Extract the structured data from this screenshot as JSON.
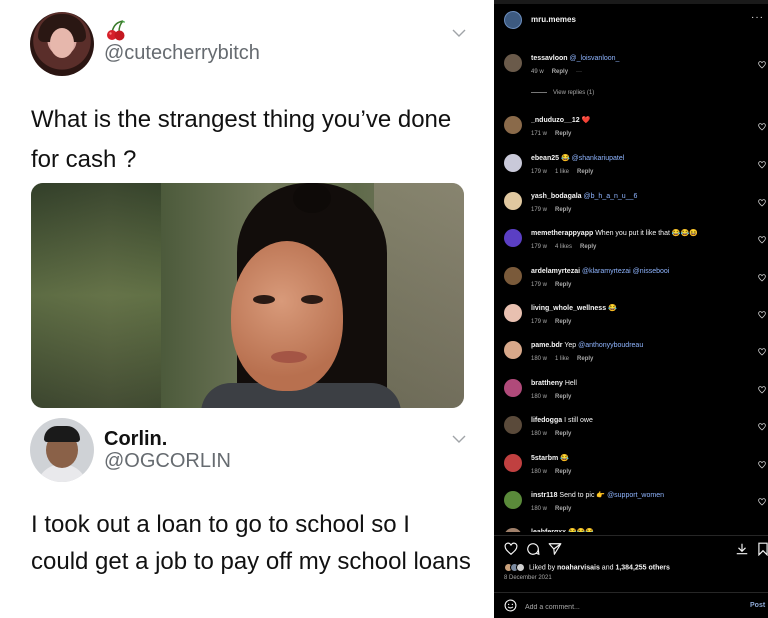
{
  "tweet1": {
    "handle": "@cutecherrybitch",
    "text": "What is the strangest thing you’ve done for cash ?"
  },
  "tweet2": {
    "name": "Corlin.",
    "handle": "@OGCORLIN",
    "text": "I took out a loan to go to school so I could get a job to pay off my school loans"
  },
  "panel": {
    "username": "mru.memes",
    "more_icon": "···"
  },
  "comments": [
    {
      "user": "tessavloon",
      "mention": "@_loisvanloon_",
      "text": "",
      "time": "49 w",
      "likes": "",
      "reply": "Reply",
      "extra": "···",
      "view_replies": "View replies (1)",
      "avatar_color": "#6a5a4a"
    },
    {
      "user": "_nduduzo__12",
      "mention": "",
      "text": "❤️",
      "time": "171 w",
      "likes": "",
      "reply": "Reply",
      "avatar_color": "#8a6a4a"
    },
    {
      "user": "ebean25",
      "mention": "@shankariupatel",
      "text": "😂",
      "time": "179 w",
      "likes": "1 like",
      "reply": "Reply",
      "avatar_color": "#c9c9d9"
    },
    {
      "user": "yash_bodagala",
      "mention": "@b_h_a_n_u__6",
      "text": "",
      "time": "179 w",
      "likes": "",
      "reply": "Reply",
      "avatar_color": "#e0c8a0"
    },
    {
      "user": "memetherappyapp",
      "mention": "",
      "text": "When you put it like that 😂😂😆",
      "time": "179 w",
      "likes": "4 likes",
      "reply": "Reply",
      "avatar_color": "#5b3fc4"
    },
    {
      "user": "ardelamyrtezai",
      "mention": "@klaramyrtezai @nissebooi",
      "text": "",
      "time": "179 w",
      "likes": "",
      "reply": "Reply",
      "avatar_color": "#7a5a3a"
    },
    {
      "user": "living_whole_wellness",
      "mention": "",
      "text": "😂",
      "time": "179 w",
      "likes": "",
      "reply": "Reply",
      "avatar_color": "#e8c0b0"
    },
    {
      "user": "pame.bdr",
      "mention": "@anthonyyboudreau",
      "text": "Yep",
      "time": "180 w",
      "likes": "1 like",
      "reply": "Reply",
      "avatar_color": "#d8a88a"
    },
    {
      "user": "brattheny",
      "mention": "",
      "text": "Hell",
      "time": "180 w",
      "likes": "",
      "reply": "Reply",
      "avatar_color": "#b04a7a"
    },
    {
      "user": "lifedogga",
      "mention": "",
      "text": "I still owe",
      "time": "180 w",
      "likes": "",
      "reply": "Reply",
      "avatar_color": "#5a4a3a"
    },
    {
      "user": "5starbm",
      "mention": "",
      "text": "😂",
      "time": "180 w",
      "likes": "",
      "reply": "Reply",
      "avatar_color": "#c04040"
    },
    {
      "user": "instr118",
      "mention": "@support_women",
      "text": "Send to pic 👉",
      "time": "180 w",
      "likes": "",
      "reply": "Reply",
      "avatar_color": "#5a8a3a"
    },
    {
      "user": "leahfergxx",
      "mention": "",
      "text": "😂😂😂",
      "time": "",
      "likes": "",
      "reply": "",
      "avatar_color": "#a0806a"
    }
  ],
  "likes": {
    "prefix": "Liked by",
    "user": "noaharvisais",
    "connector": "and",
    "count": "1,384,255 others"
  },
  "date": "8 December 2021",
  "add_comment": {
    "placeholder": "Add a comment...",
    "post_label": "Post"
  },
  "icons": [
    "heart-icon",
    "comment-icon",
    "share-icon",
    "download-icon",
    "bookmark-icon",
    "emoji-icon",
    "chevron-down-icon",
    "cherry-icon"
  ]
}
